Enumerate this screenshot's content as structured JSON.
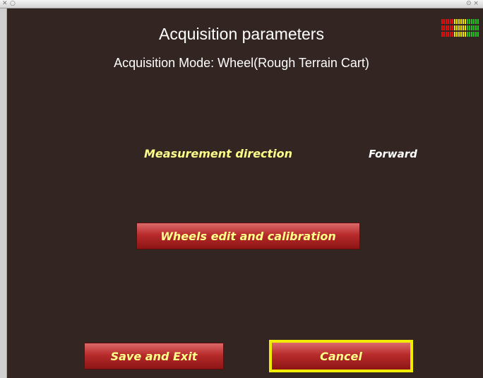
{
  "titlebar": {
    "close_glyph": "✕",
    "menu_glyph": "○",
    "right_glyphs": "⊙ ×"
  },
  "screen": {
    "title": "Acquisition parameters",
    "subtitle": "Acquisition Mode: Wheel(Rough Terrain Cart)"
  },
  "measurement": {
    "label": "Measurement direction",
    "value": "Forward"
  },
  "buttons": {
    "wheels": "Wheels edit and calibration",
    "save": "Save and Exit",
    "cancel": "Cancel"
  },
  "level_meter": {
    "colors": {
      "red": "#e01010",
      "yellow": "#f0e800",
      "green": "#20c020"
    },
    "segments_red": 6,
    "segments_yellow": 6,
    "segments_green": 6,
    "rows": 3
  },
  "colors": {
    "background": "#332521",
    "button_accent": "#b82b2b",
    "label_yellow": "#ffff8a",
    "focus_border": "#f2ec00"
  }
}
